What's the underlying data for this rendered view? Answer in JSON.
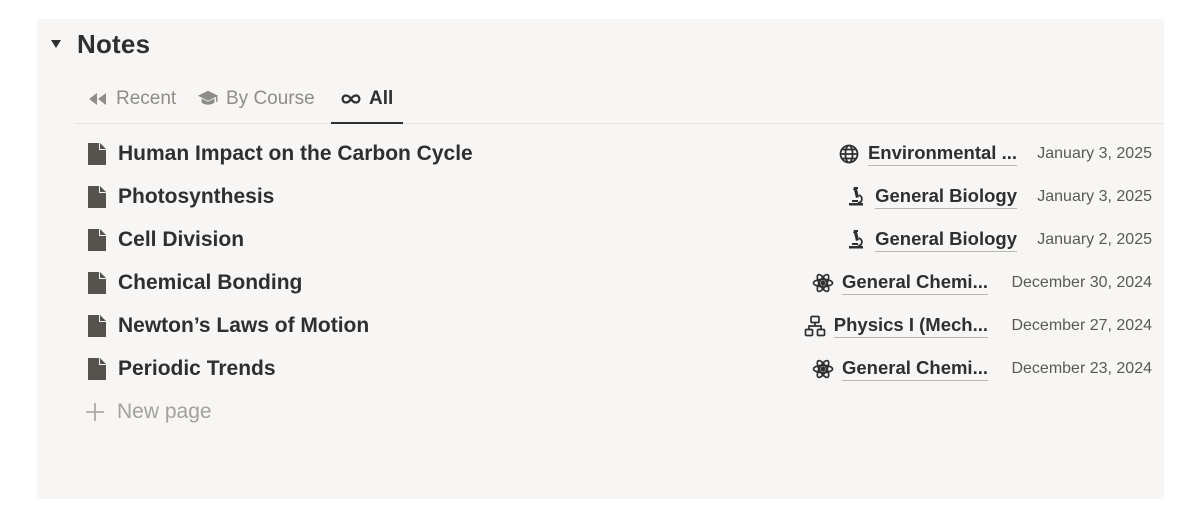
{
  "section": {
    "title": "Notes"
  },
  "tabs": [
    {
      "label": "Recent",
      "icon": "rewind-icon",
      "active": false
    },
    {
      "label": "By Course",
      "icon": "graduation-cap-icon",
      "active": false
    },
    {
      "label": "All",
      "icon": "infinity-icon",
      "active": true
    }
  ],
  "rows": [
    {
      "title": "Human Impact on the Carbon Cycle",
      "course": "Environmental ...",
      "course_icon": "globe-icon",
      "date": "January 3, 2025"
    },
    {
      "title": "Photosynthesis",
      "course": "General Biology",
      "course_icon": "microscope-icon",
      "date": "January 3, 2025"
    },
    {
      "title": "Cell Division",
      "course": "General Biology",
      "course_icon": "microscope-icon",
      "date": "January 2, 2025"
    },
    {
      "title": "Chemical Bonding",
      "course": "General Chemi...",
      "course_icon": "atom-icon",
      "date": "December 30, 2024"
    },
    {
      "title": "Newton’s Laws of Motion",
      "course": "Physics I (Mech...",
      "course_icon": "hierarchy-icon",
      "date": "December 27, 2024"
    },
    {
      "title": "Periodic Trends",
      "course": "General Chemi...",
      "course_icon": "atom-icon",
      "date": "December 23, 2024"
    }
  ],
  "new_page_label": "New page",
  "colors": {
    "panel_bg": "#f7f6f5",
    "text": "#2f2f2f",
    "muted": "#8f8d89"
  }
}
